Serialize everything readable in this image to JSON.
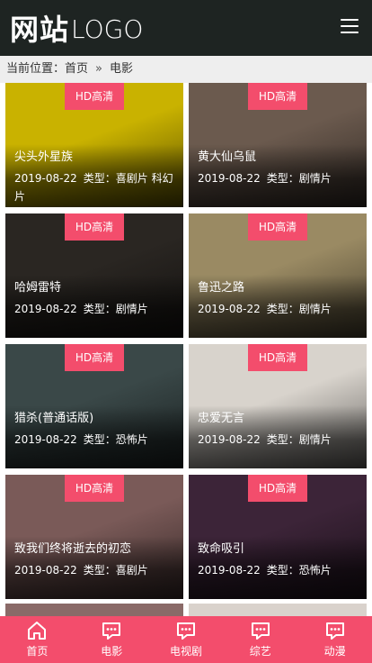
{
  "header": {
    "logo_cn": "网站",
    "logo_en": "LOGO",
    "menu_icon": "hamburger-menu-icon"
  },
  "breadcrumb": {
    "prefix": "当前位置：",
    "home": "首页",
    "separator": "»",
    "current": "电影"
  },
  "badge_label": "HD高清",
  "movies": [
    {
      "title": "尖头外星族",
      "date": "2019-08-22",
      "type": "类型：喜剧片 科幻片",
      "poster_bg": "#c9b200"
    },
    {
      "title": "黄大仙乌鼠",
      "date": "2019-08-22",
      "type": "类型：剧情片",
      "poster_bg": "#6b5a4e"
    },
    {
      "title": "哈姆雷特",
      "date": "2019-08-22",
      "type": "类型：剧情片",
      "poster_bg": "#2a2622"
    },
    {
      "title": "鲁迅之路",
      "date": "2019-08-22",
      "type": "类型：剧情片",
      "poster_bg": "#9a8a63"
    },
    {
      "title": "猎杀(普通话版)",
      "date": "2019-08-22",
      "type": "类型：恐怖片",
      "poster_bg": "#3a4848"
    },
    {
      "title": "忠爱无言",
      "date": "2019-08-22",
      "type": "类型：剧情片",
      "poster_bg": "#d8d3cc"
    },
    {
      "title": "致我们终将逝去的初恋",
      "date": "2019-08-22",
      "type": "类型：喜剧片",
      "poster_bg": "#7a5a58"
    },
    {
      "title": "致命吸引",
      "date": "2019-08-22",
      "type": "类型：恐怖片",
      "poster_bg": "#3c2438"
    }
  ],
  "tabbar": [
    {
      "label": "首页",
      "icon": "home-icon"
    },
    {
      "label": "电影",
      "icon": "chat-bubble-icon"
    },
    {
      "label": "电视剧",
      "icon": "chat-bubble-icon"
    },
    {
      "label": "综艺",
      "icon": "chat-bubble-icon"
    },
    {
      "label": "动漫",
      "icon": "chat-bubble-icon"
    }
  ],
  "colors": {
    "header_bg": "#1e2422",
    "accent": "#f34d6c",
    "breadcrumb_bg": "#eeeeee"
  }
}
